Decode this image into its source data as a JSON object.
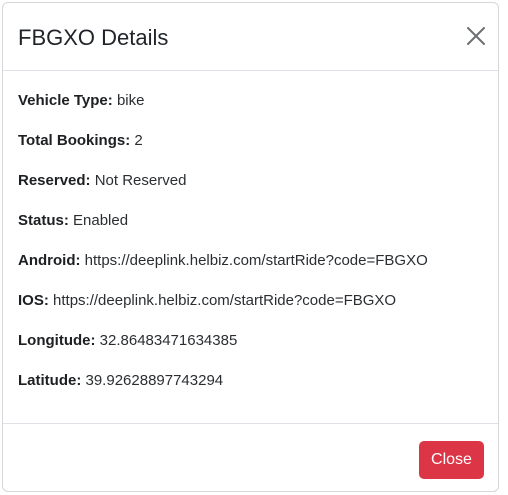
{
  "modal": {
    "title": "FBGXO Details",
    "close_icon": "close-icon"
  },
  "details": [
    {
      "label": "Vehicle Type:",
      "value": "bike"
    },
    {
      "label": "Total Bookings:",
      "value": "2"
    },
    {
      "label": "Reserved:",
      "value": "Not Reserved"
    },
    {
      "label": "Status:",
      "value": "Enabled"
    },
    {
      "label": "Android:",
      "value": "https://deeplink.helbiz.com/startRide?code=FBGXO"
    },
    {
      "label": "IOS:",
      "value": "https://deeplink.helbiz.com/startRide?code=FBGXO"
    },
    {
      "label": "Longitude:",
      "value": "32.86483471634385"
    },
    {
      "label": "Latitude:",
      "value": "39.92628897743294"
    }
  ],
  "footer": {
    "close_label": "Close"
  },
  "colors": {
    "danger": "#dc3545",
    "text": "#212529",
    "divider": "#dee2e6"
  }
}
